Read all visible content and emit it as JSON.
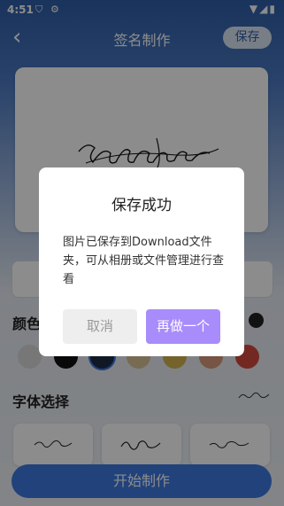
{
  "status_bar": {
    "time": "4:51"
  },
  "header": {
    "title": "签名制作",
    "save_label": "保存"
  },
  "sections": {
    "color_label": "颜色",
    "font_label": "字体选择"
  },
  "colors": [
    "#d9d9d9",
    "#111111",
    "#1f2d44",
    "#d9c49a",
    "#d6b450",
    "#d99a7a",
    "#d24b3f"
  ],
  "start_button": "开始制作",
  "dialog": {
    "title": "保存成功",
    "message_line1": "图片已保存到Download文件",
    "message_line2": "夹，可从相册或文件管理进行查",
    "message_line3": "看",
    "cancel_label": "取消",
    "redo_label": "再做一个"
  }
}
